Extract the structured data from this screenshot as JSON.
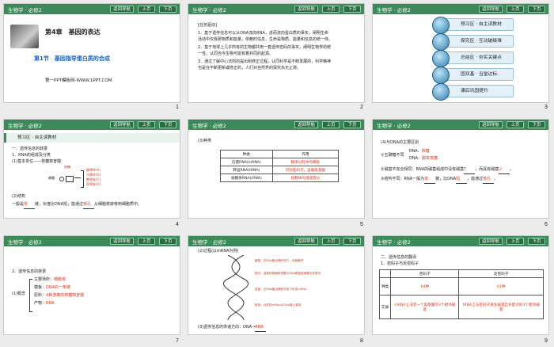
{
  "header": {
    "subject": "生物学 · 必修2",
    "nav_label": "返回导航",
    "prev_label": "上页",
    "next_label": "下页"
  },
  "slides": [
    {
      "number": "1",
      "chapter": "第4章　基因的表达",
      "section": "第1节　基因指导蛋白质的合成",
      "footer": "第一PPT模板网-WWW.1PPT.COM"
    },
    {
      "number": "2",
      "title": "[任务驱动]",
      "lines": [
        "1．基于遗传信息可以从DNA流向RNA，进而流向蛋白质的事实，阐明生命",
        "活动中仅靠那物质和能量，依赖时信息，生命是物质、能量和信息的统一体。",
        "2．基于地球上几乎所有的生物都共用一套遗传密码的事实，阐明生物界的统",
        "一性，认同当今生物可能有着共同的起源。",
        "3．通过了解中心法则的提出和修正过程，认同科学是不断发展的，科学精神",
        "也是在不断更新或修正的，人们对自然界的探究永无止境。"
      ]
    },
    {
      "number": "3",
      "menu": [
        "预习区 · 自主读教材",
        "探究区 · 互动破疑难",
        "总结区 · 夯实关键点",
        "固双基 · 当堂达标",
        "课后巩固提升"
      ]
    },
    {
      "number": "4",
      "banner": "预习区 · 自主读教材",
      "lines": [
        "一、遗传信息的转录",
        "1．RNA的组成及分类",
        "(1)基本单位——核糖核苷酸",
        "(2)结构",
        "一般是",
        "单",
        "链，长度比DNA短；能通过",
        "核孔",
        "从细胞核转移到细胞质中。"
      ],
      "labels": [
        "磷酸",
        "核糖",
        "腺嘌呤(A)",
        "鸟嘌呤(G)",
        "胞嘧啶(C)",
        "尿嘧啶(U)"
      ]
    },
    {
      "number": "5",
      "title": "(3)种类",
      "table": {
        "headers": [
          "种类",
          "作用"
        ],
        "rows": [
          [
            "信使RNA(mRNA)",
            "翻译过程中的模板"
          ],
          [
            "转运RNA(tRNA)",
            "识别密码子，运载氨基酸"
          ],
          [
            "核糖体RNA(rRNA)",
            "核糖体的组成成分"
          ]
        ]
      }
    },
    {
      "number": "6",
      "title": "(4)与DNA的主要区别",
      "lines": [
        "①五碳糖不同",
        "RNA：",
        "核糖",
        "DNA：",
        "脱氧核糖",
        "②碱基不完全相同：RNA的碱基组成中没有碱基",
        "T",
        "，而具有碱基",
        "U",
        "。",
        "③结构不同：RNA一般为",
        "单",
        "链，比DNA",
        "短",
        "，能通过",
        "核孔",
        "。"
      ]
    },
    {
      "number": "7",
      "title": "2．遗传信息的转录",
      "lines": [
        "(1)概念",
        "主要场所：",
        "细胞核",
        "模板：",
        "DNA的一条链",
        "原料：",
        "4种游离的核糖核苷酸",
        "产物：",
        "RNA"
      ]
    },
    {
      "number": "8",
      "title": "(2)过程(以mRNA为例)",
      "caption": "(3)遗传信息的传递方向：DNA→",
      "caption_red": "RNA",
      "notes": [
        "解旋：在RNA聚合酶作用下，双链解开",
        "配对：游离的核糖核苷酸与DNA模板链碱基互补配对",
        "连接：在RNA聚合酶的作用下形成mRNA",
        "释放：合成的mRNA从DNA链上释放"
      ]
    },
    {
      "number": "9",
      "title": "二、遗传信息的翻译",
      "sub": "1．密码子与反密码子",
      "table": {
        "headers": [
          "",
          "密码子",
          "反密码子"
        ],
        "rows": [
          [
            "种类",
            "64种",
            "61种"
          ],
          [
            "实质",
            "mRNA上决定一个氨基酸的3个相邻碱基",
            "tRNA上与密码子发生碱基互补配对的3个相邻碱基"
          ]
        ]
      }
    }
  ],
  "colors": {
    "header": "#3c8a5a",
    "accent_red": "#d23a1e"
  }
}
